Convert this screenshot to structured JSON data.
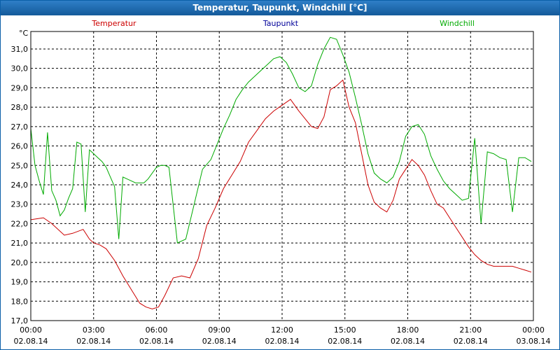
{
  "window": {
    "title": "Temperatur, Taupunkt, Windchill [°C]"
  },
  "chart_data": {
    "type": "line",
    "title": "Temperatur, Taupunkt, Windchill [°C]",
    "ylabel": "°C",
    "ylim": [
      17.0,
      31.9
    ],
    "xlim": [
      0,
      24
    ],
    "grid": true,
    "legend_placement": "top",
    "y_ticks": [
      "17,0",
      "18,0",
      "19,0",
      "20,0",
      "21,0",
      "22,0",
      "23,0",
      "24,0",
      "25,0",
      "26,0",
      "27,0",
      "28,0",
      "29,0",
      "30,0",
      "31,0"
    ],
    "x_ticks": [
      {
        "time": "00:00",
        "date": "02.08.14"
      },
      {
        "time": "03:00",
        "date": "02.08.14"
      },
      {
        "time": "06:00",
        "date": "02.08.14"
      },
      {
        "time": "09:00",
        "date": "02.08.14"
      },
      {
        "time": "12:00",
        "date": "02.08.14"
      },
      {
        "time": "15:00",
        "date": "02.08.14"
      },
      {
        "time": "18:00",
        "date": "02.08.14"
      },
      {
        "time": "21:00",
        "date": "02.08.14"
      },
      {
        "time": "00:00",
        "date": "03.08.14"
      }
    ],
    "series": [
      {
        "name": "Temperatur",
        "color": "#cc0000",
        "x": [
          0,
          0.6,
          1.0,
          1.6,
          2.0,
          2.5,
          2.8,
          3.0,
          3.3,
          3.6,
          4.0,
          4.4,
          4.8,
          5.2,
          5.5,
          5.8,
          6.1,
          6.4,
          6.8,
          7.2,
          7.6,
          8.0,
          8.4,
          8.8,
          9.2,
          9.6,
          10.0,
          10.4,
          10.8,
          11.2,
          11.6,
          12.0,
          12.4,
          12.8,
          13.1,
          13.4,
          13.7,
          14.0,
          14.3,
          14.6,
          14.9,
          15.2,
          15.5,
          15.8,
          16.1,
          16.4,
          16.7,
          17.0,
          17.3,
          17.6,
          17.9,
          18.2,
          18.5,
          18.8,
          19.1,
          19.4,
          19.7,
          20.0,
          20.3,
          20.6,
          20.9,
          21.2,
          21.5,
          21.8,
          22.1,
          22.4,
          22.7,
          23.0,
          23.3,
          23.6,
          23.9
        ],
        "values": [
          22.2,
          22.3,
          22.0,
          21.4,
          21.5,
          21.7,
          21.2,
          21.0,
          20.9,
          20.7,
          20.1,
          19.3,
          18.6,
          17.9,
          17.7,
          17.6,
          17.7,
          18.3,
          19.2,
          19.3,
          19.2,
          20.2,
          21.9,
          22.8,
          23.8,
          24.5,
          25.2,
          26.2,
          26.8,
          27.4,
          27.8,
          28.1,
          28.4,
          27.8,
          27.4,
          27.0,
          26.9,
          27.5,
          28.9,
          29.1,
          29.4,
          28.0,
          27.2,
          25.6,
          24.0,
          23.1,
          22.8,
          22.6,
          23.2,
          24.3,
          24.8,
          25.3,
          25.0,
          24.5,
          23.7,
          23.0,
          22.8,
          22.3,
          21.8,
          21.3,
          20.8,
          20.4,
          20.1,
          19.9,
          19.8,
          19.8,
          19.8,
          19.8,
          19.7,
          19.6,
          19.5
        ]
      },
      {
        "name": "Taupunkt",
        "color": "#000099",
        "x": [],
        "values": []
      },
      {
        "name": "Windchill",
        "color": "#00aa00",
        "x": [
          0,
          0.2,
          0.4,
          0.6,
          0.8,
          1.0,
          1.2,
          1.4,
          1.6,
          1.8,
          2.0,
          2.2,
          2.4,
          2.6,
          2.8,
          3.0,
          3.2,
          3.4,
          3.6,
          3.8,
          4.0,
          4.2,
          4.4,
          4.6,
          4.8,
          5.0,
          5.2,
          5.4,
          5.6,
          5.8,
          6.0,
          6.2,
          6.4,
          6.6,
          7.0,
          7.4,
          7.8,
          8.2,
          8.6,
          8.9,
          9.2,
          9.5,
          9.8,
          10.1,
          10.4,
          10.7,
          11.0,
          11.3,
          11.6,
          11.9,
          12.2,
          12.5,
          12.8,
          13.1,
          13.4,
          13.7,
          14.0,
          14.3,
          14.6,
          14.9,
          15.2,
          15.5,
          15.8,
          16.1,
          16.4,
          16.7,
          17.0,
          17.3,
          17.6,
          17.9,
          18.2,
          18.5,
          18.8,
          19.1,
          19.4,
          19.7,
          20.0,
          20.3,
          20.6,
          20.9,
          21.2,
          21.5,
          21.8,
          22.1,
          22.4,
          22.7,
          23.0,
          23.3,
          23.6,
          23.9
        ],
        "values": [
          26.9,
          25.0,
          24.2,
          23.5,
          26.7,
          23.7,
          23.2,
          22.4,
          22.7,
          23.3,
          23.8,
          26.2,
          26.1,
          22.6,
          25.8,
          25.6,
          25.4,
          25.2,
          24.9,
          24.4,
          23.9,
          21.2,
          24.4,
          24.3,
          24.2,
          24.1,
          24.1,
          24.1,
          24.3,
          24.6,
          24.9,
          25.0,
          25.0,
          24.9,
          21.0,
          21.2,
          23.0,
          24.8,
          25.3,
          26.1,
          26.9,
          27.6,
          28.4,
          28.9,
          29.3,
          29.6,
          29.9,
          30.2,
          30.5,
          30.6,
          30.3,
          29.7,
          29.0,
          28.8,
          29.1,
          30.2,
          31.0,
          31.6,
          31.5,
          30.7,
          29.8,
          28.5,
          27.1,
          25.6,
          24.6,
          24.3,
          24.1,
          24.4,
          25.2,
          26.5,
          27.0,
          27.1,
          26.6,
          25.5,
          24.8,
          24.2,
          23.8,
          23.5,
          23.2,
          23.3,
          26.4,
          22.0,
          25.7,
          25.6,
          25.4,
          25.3,
          22.6,
          25.4,
          25.4,
          25.2
        ]
      }
    ]
  }
}
